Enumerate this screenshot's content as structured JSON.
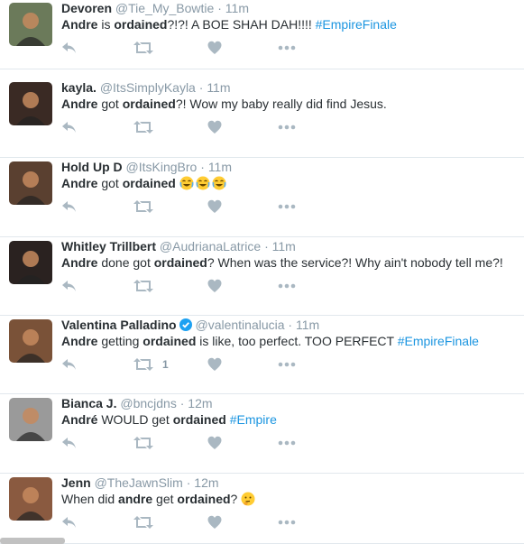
{
  "tweets": [
    {
      "name": "Devoren",
      "handle": "@Tie_My_Bowtie",
      "sep": "·",
      "time": "11m",
      "text": [
        {
          "t": "Andre",
          "b": true
        },
        {
          "t": " is "
        },
        {
          "t": "ordained",
          "b": true
        },
        {
          "t": "?!?! A BOE SHAH DAH!!!! "
        },
        {
          "t": "#EmpireFinale",
          "h": true
        }
      ],
      "avatar": "#6b7a5a"
    },
    {
      "name": "kayla.",
      "handle": "@ItsSimplyKayla",
      "sep": "·",
      "time": "11m",
      "text": [
        {
          "t": "Andre",
          "b": true
        },
        {
          "t": " got "
        },
        {
          "t": "ordained",
          "b": true
        },
        {
          "t": "?! Wow my baby really did find Jesus."
        }
      ],
      "avatar": "#3a2a24"
    },
    {
      "name": "Hold Up D",
      "handle": "@ItsKingBro",
      "sep": "·",
      "time": "11m",
      "text": [
        {
          "t": "Andre",
          "b": true
        },
        {
          "t": " got "
        },
        {
          "t": "ordained",
          "b": true
        },
        {
          "t": " "
        }
      ],
      "emojis": [
        "face-with-tears-of-joy-icon",
        "face-with-tears-of-joy-icon",
        "face-with-tears-of-joy-icon"
      ],
      "avatar": "#5a4030"
    },
    {
      "name": "Whitley Trillbert",
      "handle": "@AudrianaLatrice",
      "sep": "·",
      "time": "11m",
      "text": [
        {
          "t": "Andre",
          "b": true
        },
        {
          "t": " done got "
        },
        {
          "t": "ordained",
          "b": true
        },
        {
          "t": "? When was the service?! Why ain't nobody tell me?!"
        }
      ],
      "avatar": "#2a2220"
    },
    {
      "name": "Valentina Palladino",
      "handle": "@valentinalucia",
      "sep": "·",
      "time": "11m",
      "verified": true,
      "text": [
        {
          "t": "Andre",
          "b": true
        },
        {
          "t": " getting "
        },
        {
          "t": "ordained",
          "b": true
        },
        {
          "t": " is like, too perfect. TOO PERFECT "
        },
        {
          "t": "#EmpireFinale",
          "h": true
        }
      ],
      "retweet_count": "1",
      "avatar": "#7a5238"
    },
    {
      "name": "Bianca J.",
      "handle": "@bncjdns",
      "sep": "·",
      "time": "12m",
      "text": [
        {
          "t": "André",
          "b": true
        },
        {
          "t": " WOULD get "
        },
        {
          "t": "ordained",
          "b": true
        },
        {
          "t": " "
        },
        {
          "t": "#Empire",
          "h": true
        }
      ],
      "avatar": "#9a9a9a"
    },
    {
      "name": "Jenn",
      "handle": "@TheJawnSlim",
      "sep": "·",
      "time": "12m",
      "text": [
        {
          "t": "When did "
        },
        {
          "t": "andre",
          "b": true
        },
        {
          "t": " get "
        },
        {
          "t": "ordained",
          "b": true
        },
        {
          "t": "? "
        }
      ],
      "emojis": [
        "thinking-face-icon"
      ],
      "avatar": "#8a5a40"
    }
  ],
  "colors": {
    "accent": "#1b95e0",
    "muted": "#8899a6",
    "icon": "#aab8c2",
    "text": "#292f33"
  }
}
